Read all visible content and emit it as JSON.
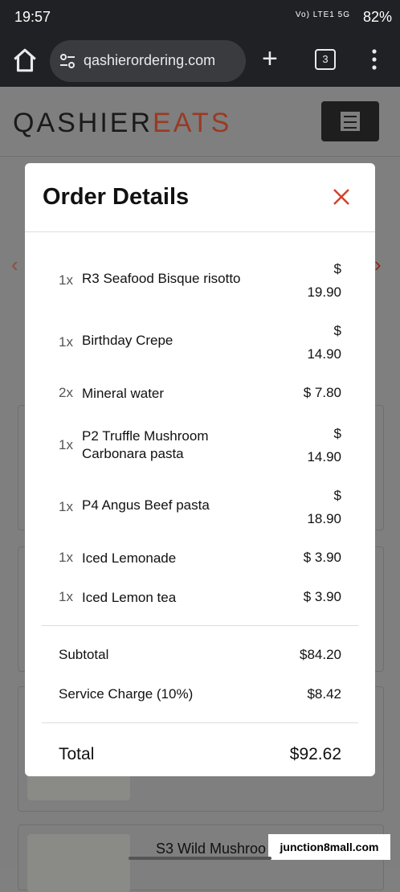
{
  "status_bar": {
    "time": "19:57",
    "indicators": "Vo) LTE1 5G",
    "battery": "82%"
  },
  "browser": {
    "url": "qashierordering.com",
    "tab_count": "3"
  },
  "site": {
    "brand_part1": "QASHIER",
    "brand_part2": "EATS"
  },
  "modal": {
    "title": "Order Details",
    "items": [
      {
        "qty": "1x",
        "name": "R3 Seafood Bisque risotto",
        "price_symbol": "$",
        "price": "19.90"
      },
      {
        "qty": "1x",
        "name": "Birthday Crepe",
        "price_symbol": "$",
        "price": "14.90"
      },
      {
        "qty": "2x",
        "name": "Mineral water",
        "price_text": "$ 7.80"
      },
      {
        "qty": "1x",
        "name": "P2 Truffle Mushroom Carbonara pasta",
        "price_symbol": "$",
        "price": "14.90"
      },
      {
        "qty": "1x",
        "name": "P4 Angus Beef pasta",
        "price_symbol": "$",
        "price": "18.90"
      },
      {
        "qty": "1x",
        "name": "Iced Lemonade",
        "price_text": "$ 3.90"
      },
      {
        "qty": "1x",
        "name": "Iced Lemon tea",
        "price_text": "$ 3.90"
      }
    ],
    "subtotal_label": "Subtotal",
    "subtotal": "$84.20",
    "service_label": "Service Charge (10%)",
    "service": "$8.42",
    "total_label": "Total",
    "total": "$92.62"
  },
  "background": {
    "partial_item": "S3 Wild Mushroo"
  },
  "watermark": "junction8mall.com",
  "colors": {
    "accent": "#d0452c",
    "brand_dark": "#1a1a1a"
  }
}
